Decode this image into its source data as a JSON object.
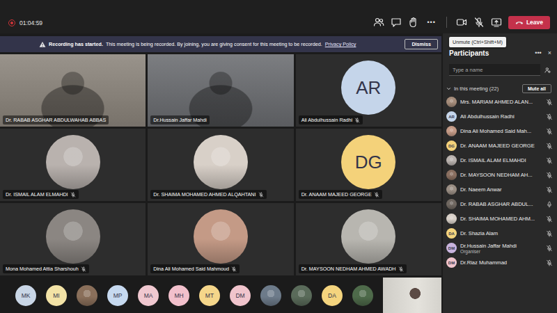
{
  "meeting_bar": {
    "timer": "01:04:59",
    "more": "•••",
    "leave": "Leave"
  },
  "tooltip": "Unmute (Ctrl+Shift+M)",
  "banner": {
    "title": "Recording has started.",
    "text": "This meeting is being recorded. By joining, you are giving consent for this meeting to be recorded.",
    "link": "Privacy Policy",
    "button": "Dismiss"
  },
  "tiles": [
    {
      "name": "Dr. RABAB ASGHAR ABDULWAHAB ABBAS",
      "kind": "video",
      "muted": false,
      "color": "#8c857c"
    },
    {
      "name": "Dr.Hussain Jaffar Mahdi",
      "kind": "video",
      "muted": false,
      "color": "#6a6c70"
    },
    {
      "name": "Ali Abdulhussain Radhi",
      "kind": "initials",
      "initials": "AR",
      "muted": true,
      "color": "#c5d5ea"
    },
    {
      "name": "Dr. ISMAIL ALAM ELMAHDI",
      "kind": "photo",
      "muted": true,
      "color": "#b9b2ae"
    },
    {
      "name": "Dr. SHAIMA MOHAMED AHMED ALQAHTANI",
      "kind": "photo",
      "muted": true,
      "color": "#d8d0c8"
    },
    {
      "name": "Dr. ANAAM MAJEED GEORGE",
      "kind": "initials",
      "initials": "DG",
      "muted": true,
      "color": "#f4d27a"
    },
    {
      "name": "Mona Mohamed Attia Sharshouh",
      "kind": "photo",
      "muted": true,
      "color": "#8b8682"
    },
    {
      "name": "Dina Ali Mohamed Said Mahmoud",
      "kind": "photo",
      "muted": true,
      "color": "#c49a86"
    },
    {
      "name": "Dr. MAYSOON NEDHAM AHMED AWADH",
      "kind": "photo",
      "muted": true,
      "color": "#b8b6b0"
    }
  ],
  "overflow": [
    {
      "kind": "initials",
      "initials": "MK",
      "color": "#c9d6e6"
    },
    {
      "kind": "initials",
      "initials": "MI",
      "color": "#f3e3a6"
    },
    {
      "kind": "photo",
      "color": "#8a6f5a"
    },
    {
      "kind": "initials",
      "initials": "MP",
      "color": "#c6d9ef"
    },
    {
      "kind": "initials",
      "initials": "MA",
      "color": "#f0c8d0"
    },
    {
      "kind": "initials",
      "initials": "MH",
      "color": "#f2c0cc"
    },
    {
      "kind": "initials",
      "initials": "MT",
      "color": "#f5d68a"
    },
    {
      "kind": "initials",
      "initials": "DM",
      "color": "#f0c4cc"
    },
    {
      "kind": "photo",
      "color": "#6d7b8a"
    },
    {
      "kind": "photo",
      "color": "#5a6b5a"
    },
    {
      "kind": "initials",
      "initials": "DA",
      "color": "#f4d47e"
    },
    {
      "kind": "photo",
      "color": "#4e6a4a"
    }
  ],
  "panel": {
    "title": "Participants",
    "more": "•••",
    "close": "×",
    "search": {
      "placeholder": "Type a name"
    },
    "section": {
      "label": "In this meeting (22)",
      "expanded": true
    },
    "mute_all": "Mute all",
    "participants": [
      {
        "name": "Mrs. MARIAM AHMED ALAN...",
        "kind": "photo",
        "color": "#a58c7a",
        "muted": true
      },
      {
        "name": "Ali Abdulhussain Radhi",
        "kind": "initials",
        "initials": "AR",
        "color": "#c5d5ea",
        "muted": true
      },
      {
        "name": "Dina Ali Mohamed Said Mah...",
        "kind": "photo",
        "color": "#c49a86",
        "muted": true
      },
      {
        "name": "Dr. ANAAM MAJEED GEORGE",
        "kind": "initials",
        "initials": "DG",
        "color": "#f4d27a",
        "muted": true
      },
      {
        "name": "Dr. ISMAIL ALAM ELMAHDI",
        "kind": "photo",
        "color": "#b9b2ae",
        "muted": true
      },
      {
        "name": "Dr. MAYSOON NEDHAM AH...",
        "kind": "photo",
        "color": "#8a6f60",
        "muted": true
      },
      {
        "name": "Dr. Naeem Anwar",
        "kind": "photo",
        "color": "#9a8e84",
        "muted": true
      },
      {
        "name": "Dr. RABAB ASGHAR ABDUL...",
        "kind": "photo",
        "color": "#6f6760",
        "muted": false
      },
      {
        "name": "Dr. SHAIMA MOHAMED AHM...",
        "kind": "photo",
        "color": "#d8d0c8",
        "muted": true
      },
      {
        "name": "Dr. Shazia Alam",
        "kind": "initials",
        "initials": "DA",
        "color": "#f4d47e",
        "muted": true
      },
      {
        "name": "Dr.Hussain Jaffar Mahdi",
        "role": "Organiser",
        "kind": "initials",
        "initials": "DM",
        "color": "#c9b4de",
        "muted": true
      },
      {
        "name": "Dr.Riaz Muhammad",
        "kind": "initials",
        "initials": "DM",
        "color": "#f0c4cc",
        "muted": true
      }
    ]
  }
}
